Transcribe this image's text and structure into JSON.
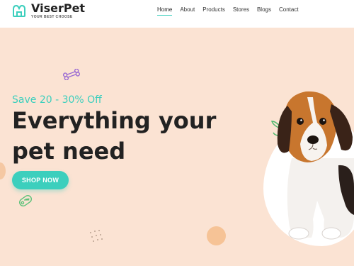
{
  "brand": {
    "name": "ViserPet",
    "tagline": "YOUR BEST CHOOSE"
  },
  "nav": {
    "items": [
      {
        "label": "Home",
        "active": true
      },
      {
        "label": "About"
      },
      {
        "label": "Products"
      },
      {
        "label": "Stores"
      },
      {
        "label": "Blogs"
      },
      {
        "label": "Contact"
      }
    ]
  },
  "hero": {
    "promo": "Save 20 - 30% Off",
    "headline": "Everything your pet need",
    "cta_label": "SHOP NOW"
  },
  "colors": {
    "accent": "#3ccfbd",
    "hero_bg": "#fbe3d3",
    "text": "#222222"
  },
  "icons": [
    "logo-paw-icon",
    "bone-icon",
    "pet-tag-icon",
    "leaf-sprig-icon",
    "dots-icon"
  ]
}
